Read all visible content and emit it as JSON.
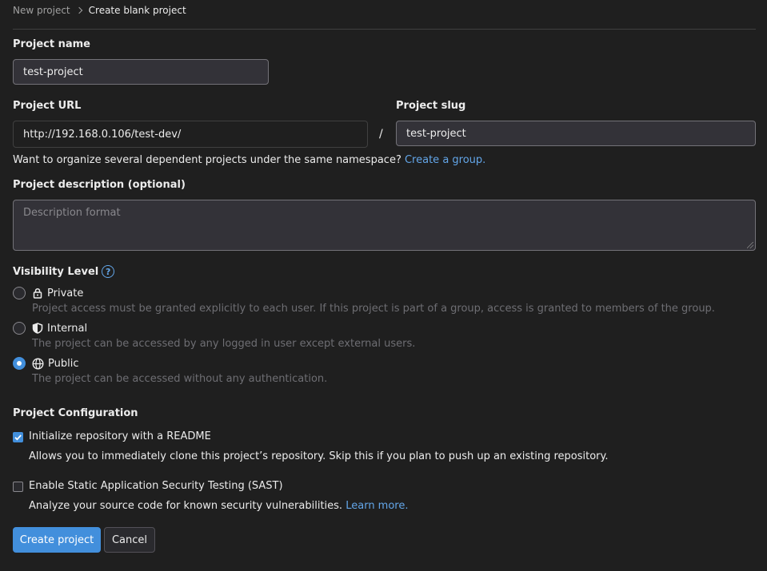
{
  "breadcrumb": {
    "parent": "New project",
    "current": "Create blank project"
  },
  "project_name": {
    "label": "Project name",
    "value": "test-project"
  },
  "project_url": {
    "label": "Project URL",
    "value": "http://192.168.0.106/test-dev/"
  },
  "separator": "/",
  "project_slug": {
    "label": "Project slug",
    "value": "test-project"
  },
  "namespace_hint": {
    "text": "Want to organize several dependent projects under the same namespace?",
    "link": "Create a group."
  },
  "description": {
    "label": "Project description (optional)",
    "placeholder": "Description format"
  },
  "visibility": {
    "label": "Visibility Level",
    "help_icon": "question-circle-icon",
    "selected": "Public",
    "options": [
      {
        "label": "Private",
        "icon": "lock-icon",
        "description": "Project access must be granted explicitly to each user. If this project is part of a group, access is granted to members of the group."
      },
      {
        "label": "Internal",
        "icon": "shield-icon",
        "description": "The project can be accessed by any logged in user except external users."
      },
      {
        "label": "Public",
        "icon": "globe-icon",
        "description": "The project can be accessed without any authentication."
      }
    ]
  },
  "configuration": {
    "label": "Project Configuration",
    "readme": {
      "label": "Initialize repository with a README",
      "checked": true,
      "description": "Allows you to immediately clone this project’s repository. Skip this if you plan to push up an existing repository."
    },
    "sast": {
      "label": "Enable Static Application Security Testing (SAST)",
      "checked": false,
      "description": "Analyze your source code for known security vulnerabilities.",
      "link": "Learn more."
    }
  },
  "buttons": {
    "create": "Create project",
    "cancel": "Cancel"
  },
  "colors": {
    "background": "#1f1f1f",
    "accent": "#428fdc",
    "link": "#63a6e9"
  }
}
